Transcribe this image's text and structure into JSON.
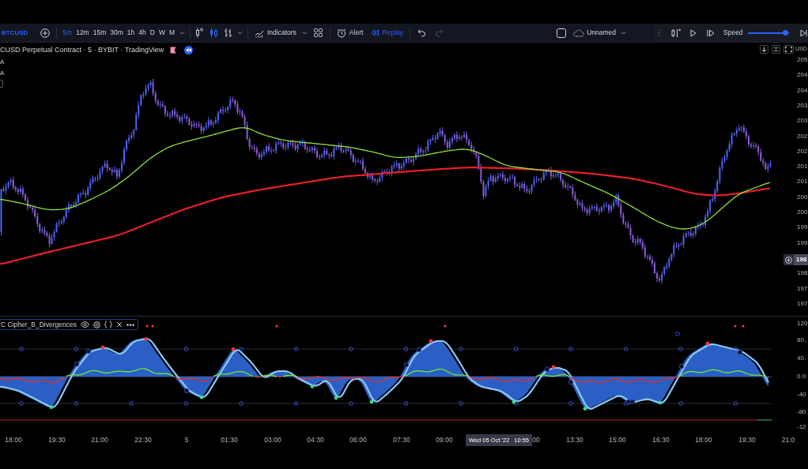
{
  "toolbar": {
    "symbol": "BTCUSD",
    "intervals": [
      {
        "label": "5m",
        "selected": true
      },
      {
        "label": "12m",
        "selected": false
      },
      {
        "label": "15m",
        "selected": false
      },
      {
        "label": "30m",
        "selected": false
      },
      {
        "label": "1h",
        "selected": false
      },
      {
        "label": "4h",
        "selected": false
      },
      {
        "label": "D",
        "selected": false
      },
      {
        "label": "W",
        "selected": false
      },
      {
        "label": "M",
        "selected": false
      }
    ],
    "chart_styles": [
      {
        "kind": "hollow",
        "selected": false
      },
      {
        "kind": "candles",
        "selected": true
      },
      {
        "kind": "bars",
        "selected": false
      }
    ],
    "indicators_label": "Indicators",
    "alert_label": "Alert",
    "replay": {
      "label": "Replay",
      "selected": true
    },
    "history": [
      {
        "kind": "undo",
        "disabled": false
      },
      {
        "kind": "redo",
        "disabled": true
      }
    ],
    "layout_name": "Unnamed"
  },
  "replay_panel": {
    "speed_label": "Speed",
    "speed": {
      "level": 0.97
    }
  },
  "legend": {
    "title": "CUSD Perpetual Contract · 5 · BYBIT · TradingView",
    "lines": [
      "A",
      "A"
    ]
  },
  "price_axis": {
    "currency": "USD",
    "labels": [
      "205",
      "204",
      "204",
      "203",
      "203",
      "202",
      "202",
      "201",
      "201",
      "200",
      "200",
      "199",
      "199",
      "198",
      "197",
      "197"
    ],
    "crosshair_label": "198"
  },
  "indicator": {
    "name": "C Cipher_B_Divergences",
    "axis_labels": [
      "120",
      "80.",
      "40.",
      "0.0",
      "-40",
      "-80",
      "-12"
    ]
  },
  "time_axis": {
    "labels": [
      "18:00",
      "19:30",
      "21:00",
      "22:30",
      "5",
      "01:30",
      "03:00",
      "04:30",
      "06:00",
      "07:30",
      "09:00",
      "00",
      "13:30",
      "15:00",
      "16:30",
      "18:00",
      "19:30",
      "21:0"
    ],
    "crosshair_date": "Wed 05 Oct '22",
    "crosshair_time": "10:55"
  }
}
